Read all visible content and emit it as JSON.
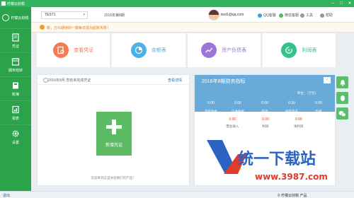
{
  "window": {
    "app_name": "柠檬云财税",
    "controls": {
      "minimize": "–",
      "maximize": "□",
      "close": "✕"
    }
  },
  "sidebar": {
    "brand": "柠檬云财税",
    "items": [
      {
        "label": "凭证",
        "icon": "voucher-icon"
      },
      {
        "label": "期末结转",
        "icon": "calendar-icon"
      },
      {
        "label": "账簿",
        "icon": "book-icon"
      },
      {
        "label": "报表",
        "icon": "report-icon"
      },
      {
        "label": "设置",
        "icon": "gear-icon"
      }
    ]
  },
  "header": {
    "ledger": "TEST1",
    "period": "2016年第8期",
    "email": "test1@qq.com",
    "links": {
      "qq": "QQ客服",
      "wechat": "微信客服",
      "tools": "工具",
      "help": "帮助"
    }
  },
  "notice": {
    "text": "新，万众期待的一键每日成功起账失败！"
  },
  "tiles": [
    {
      "label": "查看凭证",
      "icon": "search-voucher-icon",
      "color": "#f47b57"
    },
    {
      "label": "余额表",
      "icon": "pie-chart-icon",
      "color": "#4ab2e6"
    },
    {
      "label": "资产负债表",
      "icon": "line-chart-icon",
      "color": "#9d76d9"
    },
    {
      "label": "利润表",
      "icon": "money-cycle-icon",
      "color": "#36c28a"
    }
  ],
  "voucher_card": {
    "title": "2016年8月 您有未完成凭证",
    "more": "查看详情",
    "add_label": "新增凭证",
    "footer": "欢迎来到这里体验我们的产品！"
  },
  "finance_card": {
    "title": "2016年8期财务指标",
    "unit": "单位：（万元）",
    "arrow": "‹",
    "metrics_top": [
      {
        "value": "0.00",
        "label": "货币资金"
      },
      {
        "value": "0.00",
        "label": "应收账款"
      },
      {
        "value": "0.00",
        "label": "存货"
      },
      {
        "value": "0.00",
        "label": "固定资产"
      },
      {
        "value": "0.00",
        "label": "负债"
      }
    ],
    "metrics_bottom": [
      {
        "value": "0.00",
        "label": "营业收入"
      },
      {
        "value": "0.00",
        "label": "利润"
      },
      {
        "value": "0.00",
        "label": "净利润"
      }
    ]
  },
  "statusbar": {
    "left": "退出",
    "right": "© 柠檬云财税 产品"
  },
  "watermark": {
    "title": "统一下载站",
    "url": "www.3987.com"
  },
  "colors": {
    "green": "#2aa34b",
    "blue_header": "#69abd8",
    "accent_red": "#e5391a"
  }
}
